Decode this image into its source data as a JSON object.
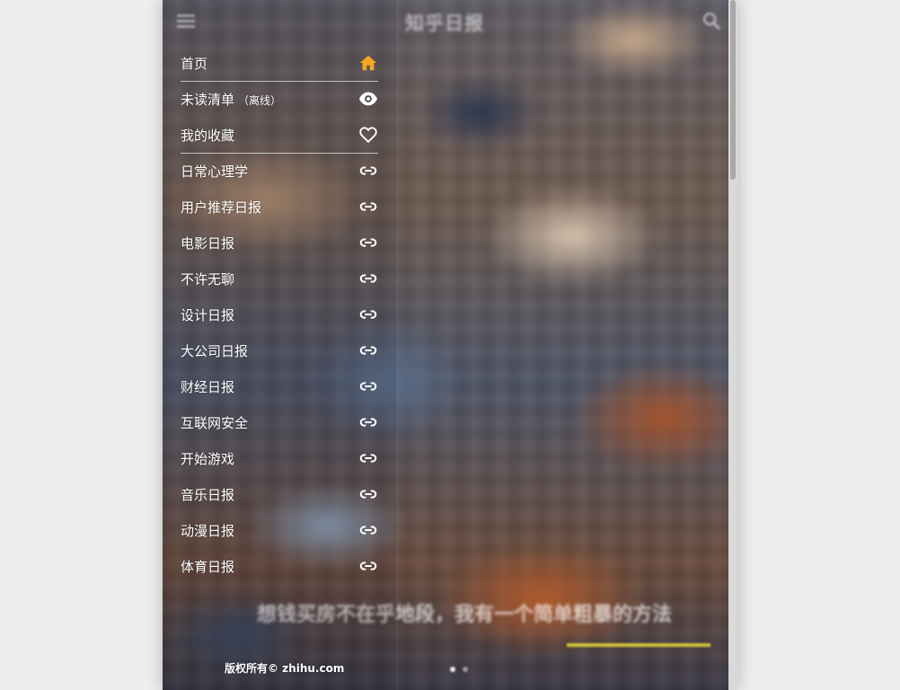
{
  "app": {
    "title": "知乎日报",
    "menu_icon": "hamburger-icon",
    "search_icon": "search-icon"
  },
  "drawer": {
    "items": [
      {
        "label": "首页",
        "suffix": "",
        "icon": "home-icon",
        "color": "#f5a623"
      },
      {
        "label": "未读清单",
        "suffix": "（离线）",
        "icon": "eye-icon",
        "color": "#ffffff"
      },
      {
        "label": "我的收藏",
        "suffix": "",
        "icon": "heart-icon",
        "color": "#ffffff"
      },
      {
        "label": "日常心理学",
        "suffix": "",
        "icon": "link-icon",
        "color": "#ffffff"
      },
      {
        "label": "用户推荐日报",
        "suffix": "",
        "icon": "link-icon",
        "color": "#ffffff"
      },
      {
        "label": "电影日报",
        "suffix": "",
        "icon": "link-icon",
        "color": "#ffffff"
      },
      {
        "label": "不许无聊",
        "suffix": "",
        "icon": "link-icon",
        "color": "#ffffff"
      },
      {
        "label": "设计日报",
        "suffix": "",
        "icon": "link-icon",
        "color": "#ffffff"
      },
      {
        "label": "大公司日报",
        "suffix": "",
        "icon": "link-icon",
        "color": "#ffffff"
      },
      {
        "label": "财经日报",
        "suffix": "",
        "icon": "link-icon",
        "color": "#ffffff"
      },
      {
        "label": "互联网安全",
        "suffix": "",
        "icon": "link-icon",
        "color": "#ffffff"
      },
      {
        "label": "开始游戏",
        "suffix": "",
        "icon": "link-icon",
        "color": "#ffffff"
      },
      {
        "label": "音乐日报",
        "suffix": "",
        "icon": "link-icon",
        "color": "#ffffff"
      },
      {
        "label": "动漫日报",
        "suffix": "",
        "icon": "link-icon",
        "color": "#ffffff"
      },
      {
        "label": "体育日报",
        "suffix": "",
        "icon": "link-icon",
        "color": "#ffffff"
      }
    ],
    "copyright": "版权所有© zhihu.com"
  },
  "banner": {
    "headline": "想钱买房不在乎地段，我有一个简单粗暴的方法",
    "accent_color": "#d6c63a"
  }
}
